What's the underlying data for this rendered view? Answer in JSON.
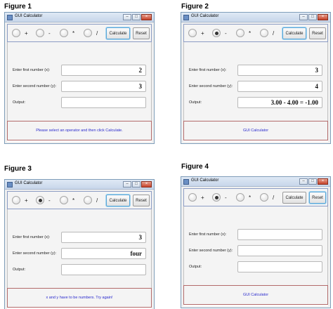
{
  "figures": [
    {
      "label": "Figure 1",
      "window_title": "GUI Calculator",
      "operators": [
        {
          "symbol": "+",
          "selected": false
        },
        {
          "symbol": "-",
          "selected": false
        },
        {
          "symbol": "*",
          "selected": false
        },
        {
          "symbol": "/",
          "selected": false
        }
      ],
      "calculate_label": "Calculate",
      "reset_label": "Reset",
      "focused_button": "calculate",
      "x_label": "Enter first number (x):",
      "x_value": "2",
      "y_label": "Enter second number (y):",
      "y_value": "3",
      "output_label": "Output:",
      "output_value": "",
      "status": "Please select an operator and then click Calculate."
    },
    {
      "label": "Figure 2",
      "window_title": "GUI Calculator",
      "operators": [
        {
          "symbol": "+",
          "selected": false
        },
        {
          "symbol": "-",
          "selected": true
        },
        {
          "symbol": "*",
          "selected": false
        },
        {
          "symbol": "/",
          "selected": false
        }
      ],
      "calculate_label": "Calculate",
      "reset_label": "Reset",
      "focused_button": "calculate",
      "x_label": "Enter first number (x):",
      "x_value": "3",
      "y_label": "Enter second number (y):",
      "y_value": "4",
      "output_label": "Output:",
      "output_value": "3.00 - 4.00 = -1.00",
      "status": "GUI Calculator"
    },
    {
      "label": "Figure 3",
      "window_title": "GUI Calculator",
      "operators": [
        {
          "symbol": "+",
          "selected": false
        },
        {
          "symbol": "-",
          "selected": true
        },
        {
          "symbol": "*",
          "selected": false
        },
        {
          "symbol": "/",
          "selected": false
        }
      ],
      "calculate_label": "Calculate",
      "reset_label": "Reset",
      "focused_button": "calculate",
      "x_label": "Enter first number (x):",
      "x_value": "3",
      "y_label": "Enter second number (y):",
      "y_value": "four",
      "output_label": "Output:",
      "output_value": "",
      "status": "x and y have to be numbers. Try again!"
    },
    {
      "label": "Figure 4",
      "window_title": "GUI Calculator",
      "operators": [
        {
          "symbol": "+",
          "selected": false
        },
        {
          "symbol": "-",
          "selected": true
        },
        {
          "symbol": "*",
          "selected": false
        },
        {
          "symbol": "/",
          "selected": false
        }
      ],
      "calculate_label": "Calculate",
      "reset_label": "Reset",
      "focused_button": "reset",
      "x_label": "Enter first number (x):",
      "x_value": "",
      "y_label": "Enter second number (y):",
      "y_value": "",
      "output_label": "Output:",
      "output_value": "",
      "status": "GUI Calculator"
    }
  ]
}
